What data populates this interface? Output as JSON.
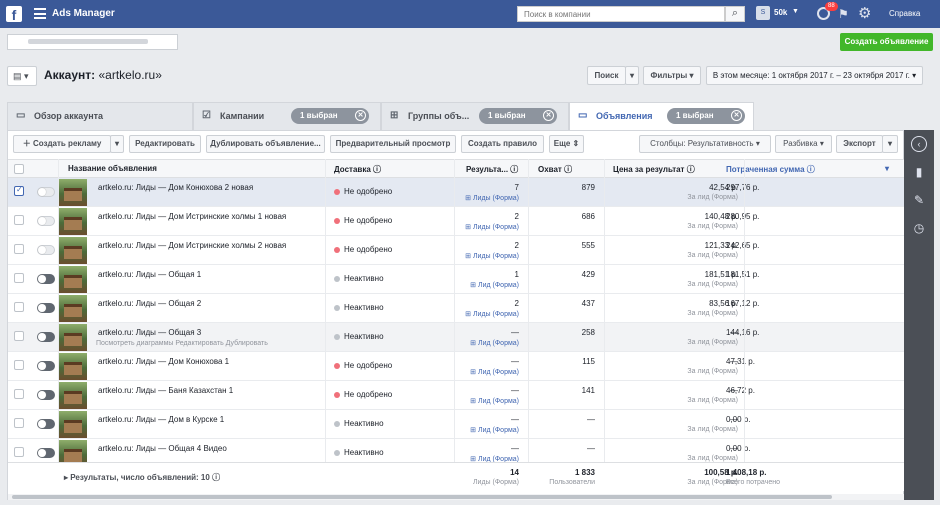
{
  "topbar": {
    "logo": "f",
    "app_name": "Ads Manager",
    "search_placeholder": "Поиск в компании",
    "account_badge": "S",
    "account_name": "50k",
    "notif_count": "88",
    "help": "Справка"
  },
  "header": {
    "create_button": "Создать объявление",
    "title_prefix": "Аккаунт:",
    "title_account": "«artkelo.ru»",
    "search_btn": "Поиск",
    "filters_btn": "Фильтры",
    "date_range": "В этом месяце: 1 октября 2017 г. – 23 октября 2017 г."
  },
  "tabs": [
    {
      "label": "Обзор аккаунта"
    },
    {
      "label": "Кампании",
      "pill": "1 выбран"
    },
    {
      "label": "Группы объ...",
      "pill": "1 выбран"
    },
    {
      "label": "Объявления",
      "pill": "1 выбран"
    }
  ],
  "toolbar": {
    "create_ad": "Создать рекламу",
    "edit": "Редактировать",
    "duplicate": "Дублировать объявление...",
    "preview": "Предварительный просмотр",
    "create_rule": "Создать правило",
    "more": "Еще",
    "columns": "Столбцы: Результативность",
    "breakdown": "Разбивка",
    "export": "Экспорт"
  },
  "columns": {
    "name": "Название объявления",
    "delivery": "Доставка",
    "results": "Результа...",
    "reach": "Охват",
    "cpr": "Цена за результат",
    "spent": "Потраченная сумма"
  },
  "rows": [
    {
      "name": "artkelo.ru: Лиды — Дом Конюхова 2 новая",
      "delivery": "Не одобрено",
      "results": "7",
      "result_label": "Лиды (Форма)",
      "reach": "879",
      "cpr": "42,54 р.",
      "cpr_label": "За лид (Форма)",
      "spent": "297,76 р."
    },
    {
      "name": "artkelo.ru: Лиды — Дом Истринские холмы 1 новая",
      "delivery": "Не одобрено",
      "results": "2",
      "result_label": "Лиды (Форма)",
      "reach": "686",
      "cpr": "140,48 р.",
      "cpr_label": "За лид (Форма)",
      "spent": "280,95 р."
    },
    {
      "name": "artkelo.ru: Лиды — Дом Истринские холмы 2 новая",
      "delivery": "Не одобрено",
      "results": "2",
      "result_label": "Лиды (Форма)",
      "reach": "555",
      "cpr": "121,33 р.",
      "cpr_label": "За лид (Форма)",
      "spent": "242,65 р."
    },
    {
      "name": "artkelo.ru: Лиды — Общая 1",
      "delivery": "Неактивно",
      "results": "1",
      "result_label": "Лид (Форма)",
      "reach": "429",
      "cpr": "181,51 р.",
      "cpr_label": "За лид (Форма)",
      "spent": "181,51 р."
    },
    {
      "name": "artkelo.ru: Лиды — Общая 2",
      "delivery": "Неактивно",
      "results": "2",
      "result_label": "Лиды (Форма)",
      "reach": "437",
      "cpr": "83,56 р.",
      "cpr_label": "За лид (Форма)",
      "spent": "167,12 р."
    },
    {
      "name": "artkelo.ru: Лиды — Общая 3",
      "delivery": "Неактивно",
      "results": "—",
      "result_label": "Лид (Форма)",
      "reach": "258",
      "cpr": "—",
      "cpr_label": "За лид (Форма)",
      "spent": "144,16 р.",
      "sub": "Посмотреть диаграммы   Редактировать   Дублировать"
    },
    {
      "name": "artkelo.ru: Лиды — Дом Конюхова 1",
      "delivery": "Не одобрено",
      "results": "—",
      "result_label": "Лид (Форма)",
      "reach": "115",
      "cpr": "—",
      "cpr_label": "За лид (Форма)",
      "spent": "47,31 р."
    },
    {
      "name": "artkelo.ru: Лиды — Баня Казахстан 1",
      "delivery": "Не одобрено",
      "results": "—",
      "result_label": "Лид (Форма)",
      "reach": "141",
      "cpr": "—",
      "cpr_label": "За лид (Форма)",
      "spent": "46,72 р."
    },
    {
      "name": "artkelo.ru: Лиды — Дом в Курске 1",
      "delivery": "Неактивно",
      "results": "—",
      "result_label": "Лид (Форма)",
      "reach": "—",
      "cpr": "—",
      "cpr_label": "За лид (Форма)",
      "spent": "0,00 р."
    },
    {
      "name": "artkelo.ru: Лиды — Общая 4 Видео",
      "delivery": "Неактивно",
      "results": "—",
      "result_label": "Лид (Форма)",
      "reach": "—",
      "cpr": "—",
      "cpr_label": "За лид (Форма)",
      "spent": "0,00 р."
    }
  ],
  "totals": {
    "label": "Результаты, число объявлений: 10",
    "results": "14",
    "results_label": "Лиды (Форма)",
    "reach": "1 833",
    "reach_label": "Пользователи",
    "cpr": "100,58 р.",
    "cpr_label": "За лид (Форма)",
    "spent": "1 408,18 р.",
    "spent_label": "Всего потрачено"
  },
  "colors": {
    "not_approved": "#f0707a",
    "inactive": "#bec3c9",
    "brand": "#3b5998",
    "create": "#42b72a"
  }
}
